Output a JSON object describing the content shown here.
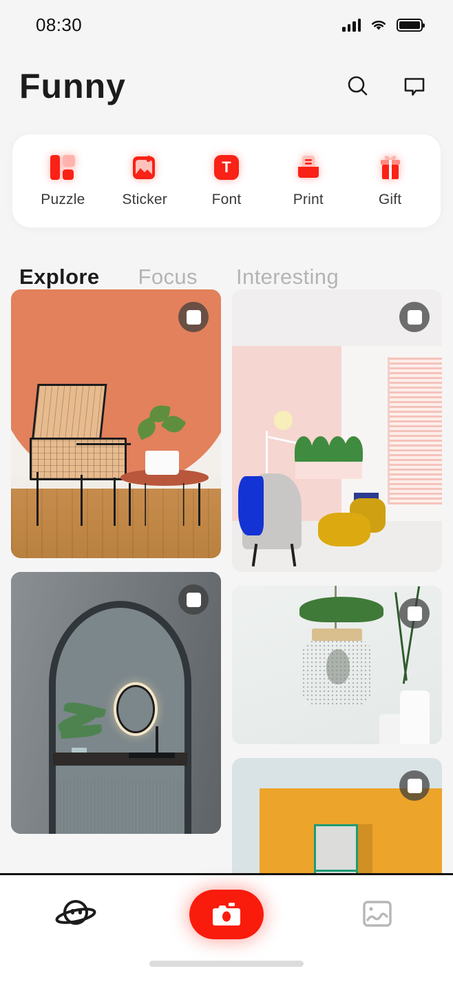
{
  "status_bar": {
    "time": "08:30",
    "signal_icon": "signal-bars-icon",
    "wifi_icon": "wifi-icon",
    "battery_icon": "battery-full-icon"
  },
  "header": {
    "brand": "Funny",
    "search_icon": "search-icon",
    "message_icon": "message-icon"
  },
  "quick_actions": {
    "items": [
      {
        "label": "Puzzle",
        "icon": "puzzle-icon"
      },
      {
        "label": "Sticker",
        "icon": "sticker-icon"
      },
      {
        "label": "Font",
        "icon": "font-icon",
        "glyph": "T"
      },
      {
        "label": "Print",
        "icon": "print-icon"
      },
      {
        "label": "Gift",
        "icon": "gift-icon"
      }
    ]
  },
  "tabs": {
    "items": [
      {
        "label": "Explore",
        "active": true
      },
      {
        "label": "Focus",
        "active": false
      },
      {
        "label": "Interesting",
        "active": false
      }
    ]
  },
  "feed": {
    "badge_icon": "multi-select-icon",
    "cards": [
      {
        "id": "card-terracotta-chair",
        "alt": "Terracotta curved wall with woven leather chair and wire side table"
      },
      {
        "id": "card-pink-room",
        "alt": "Pink wall room with grey armchair, blue throw and yellow ottomans"
      },
      {
        "id": "card-grey-arch",
        "alt": "Grey archway into kitchen with round ring light and plant"
      },
      {
        "id": "card-green-lamp",
        "alt": "Green glass pendant lamp with monstera leaf and white vase"
      },
      {
        "id": "card-orange-wall",
        "alt": "Orange wall with green framed shelf"
      }
    ]
  },
  "bottom_nav": {
    "items": [
      {
        "name": "planet-icon",
        "label": ""
      },
      {
        "name": "camera-icon",
        "label": ""
      },
      {
        "name": "gallery-icon",
        "label": ""
      }
    ]
  },
  "colors": {
    "accent": "#f91c0c",
    "background": "#f5f5f5",
    "card": "#ffffff",
    "text_primary": "#1c1c1c",
    "text_muted": "#b4b4b4"
  }
}
